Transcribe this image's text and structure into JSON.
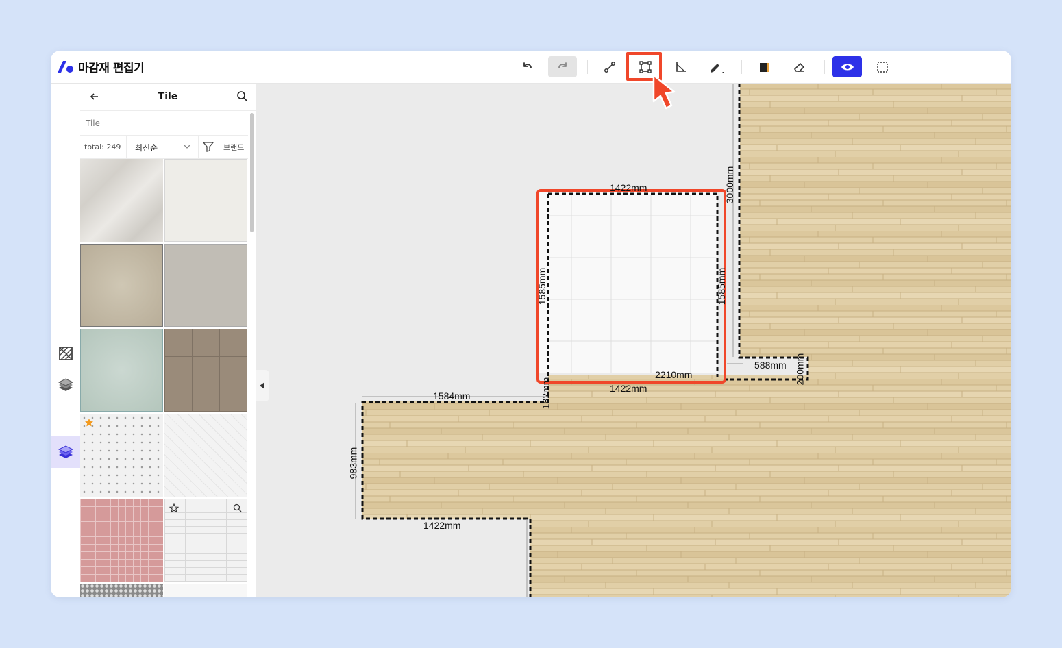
{
  "app": {
    "title": "마감재 편집기"
  },
  "toolbar": {
    "tools": [
      "undo-icon",
      "redo-icon",
      "line-tool-icon",
      "rectangle-tool-icon",
      "angle-tool-icon",
      "pencil-tool-icon",
      "material-fill-icon",
      "eraser-icon",
      "eye-icon",
      "select-area-icon"
    ],
    "highlighted_tool": "rectangle-tool-icon",
    "accent": "#2d31e8",
    "highlight_color": "#f0472a"
  },
  "rail": {
    "items": [
      "no-pattern-icon",
      "layers-icon",
      "layers-active-icon"
    ],
    "active": "layers-active-icon"
  },
  "panel": {
    "title": "Tile",
    "search_placeholder": "Tile",
    "total": "total: 249",
    "sort": "최신순",
    "filter_label": "브랜드"
  },
  "dimensions": {
    "room_top": "1422mm",
    "room_bottom": "1422mm",
    "room_left": "1585mm",
    "room_right": "1585mm",
    "room_inner": "2210mm",
    "wall_vertical": "3000mm",
    "step_width": "588mm",
    "step_height": "200mm",
    "lower_top": "1584mm",
    "lower_left": "983mm",
    "lower_bottom": "1422mm",
    "small_vertical": "182mm"
  }
}
